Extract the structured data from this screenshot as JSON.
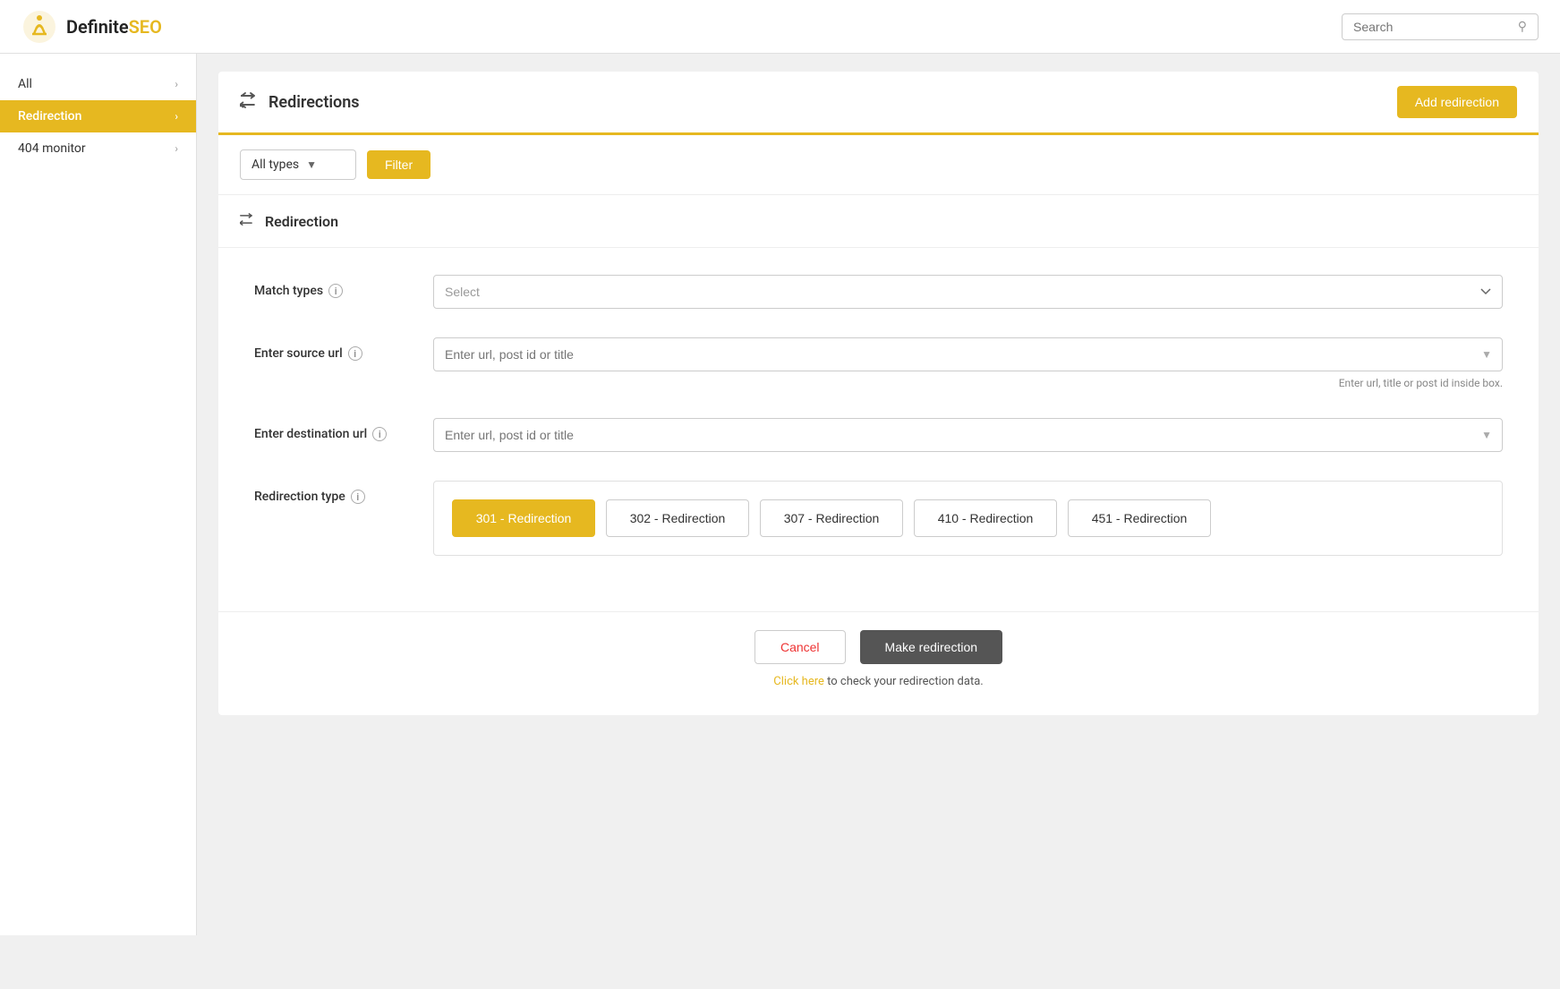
{
  "header": {
    "logo_text_definite": "Definite",
    "logo_text_seo": "SEO",
    "search_placeholder": "Search"
  },
  "sidebar": {
    "items": [
      {
        "label": "All",
        "active": false
      },
      {
        "label": "Redirection",
        "active": true
      },
      {
        "label": "404 monitor",
        "active": false
      }
    ]
  },
  "page": {
    "title": "Redirections",
    "add_button_label": "Add redirection"
  },
  "filter_bar": {
    "all_types_label": "All types",
    "filter_button_label": "Filter"
  },
  "form_section": {
    "title": "Redirection",
    "match_types_label": "Match types",
    "match_types_placeholder": "Select",
    "source_url_label": "Enter source url",
    "source_url_placeholder": "Enter url, post id or title",
    "source_url_hint": "Enter url, title or post id inside box.",
    "destination_url_label": "Enter destination url",
    "destination_url_placeholder": "Enter url, post id or title",
    "redirection_type_label": "Redirection type",
    "redirect_types": [
      {
        "label": "301 - Redirection",
        "active": true
      },
      {
        "label": "302 - Redirection",
        "active": false
      },
      {
        "label": "307 - Redirection",
        "active": false
      },
      {
        "label": "410 - Redirection",
        "active": false
      },
      {
        "label": "451 - Redirection",
        "active": false
      }
    ]
  },
  "actions": {
    "cancel_label": "Cancel",
    "make_redirect_label": "Make redirection",
    "check_link_text": "to check your redirection data.",
    "click_here_label": "Click here"
  }
}
